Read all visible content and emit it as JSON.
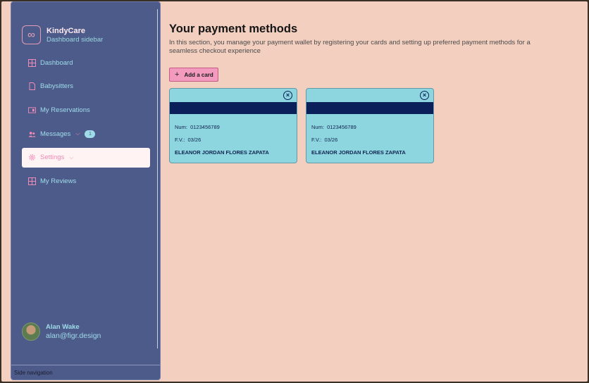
{
  "sidebar": {
    "brand": {
      "name": "KindyCare",
      "subtitle": "Dashboard sidebar",
      "icon": "infinity-icon"
    },
    "items": [
      {
        "label": "Dashboard",
        "icon": "grid-icon"
      },
      {
        "label": "Babysitters",
        "icon": "file-icon"
      },
      {
        "label": "My Reservations",
        "icon": "reservation-icon"
      },
      {
        "label": "Messages",
        "icon": "users-icon",
        "badge": "1"
      },
      {
        "label": "Settings",
        "icon": "gear-icon",
        "active": true
      },
      {
        "label": "My Reviews",
        "icon": "grid-icon"
      }
    ],
    "profile": {
      "name": "Alan Wake",
      "email": "alan@figr.design"
    },
    "footer": "Side navigation"
  },
  "main": {
    "title": "Your payment methods",
    "description": "In this section, you manage your payment wallet by registering your cards and setting up preferred payment methods for a seamless checkout experience",
    "add_button": "Add a card",
    "cards": [
      {
        "num_label": "Num:",
        "num": "0123456789",
        "fv_label": "F.V.:",
        "fv": "03/26",
        "owner": "ELEANOR JORDAN FLORES ZAPATA"
      },
      {
        "num_label": "Num:",
        "num": "0123456789",
        "fv_label": "F.V.:",
        "fv": "03/26",
        "owner": "ELEANOR JORDAN FLORES ZAPATA"
      }
    ]
  },
  "colors": {
    "sidebar_bg": "#4d5b8a",
    "page_bg": "#f3cfc0",
    "accent_pink": "#f08ab6",
    "accent_cyan": "#9fdcea",
    "card_bg": "#8dd5df",
    "card_strip": "#0b1f5a"
  }
}
